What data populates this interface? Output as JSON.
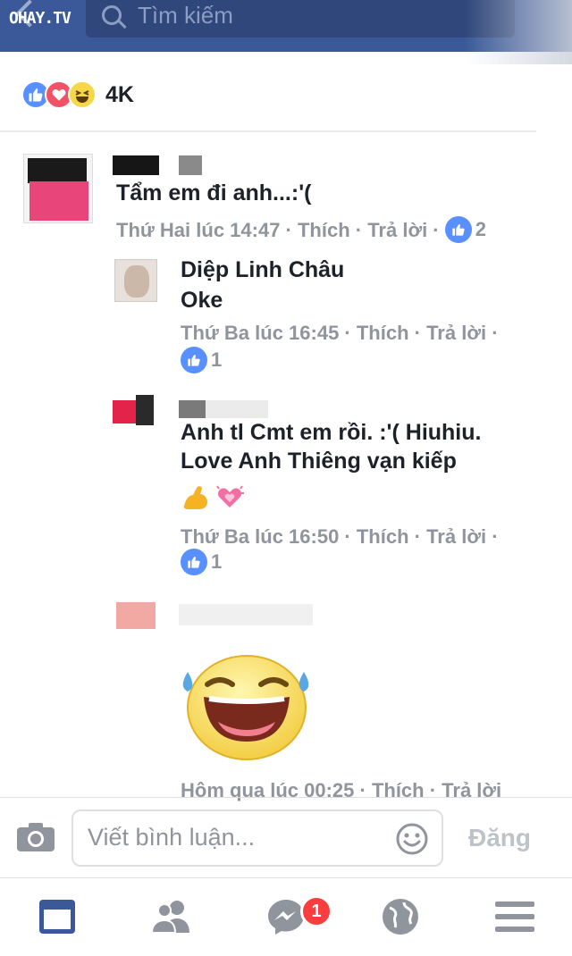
{
  "header": {
    "brand": "OHAY.TV",
    "search_placeholder": "Tìm kiếm"
  },
  "reactions": {
    "icons": [
      "like-icon",
      "love-icon",
      "haha-icon"
    ],
    "count": "4K"
  },
  "comments": [
    {
      "name": "",
      "text": "Tẩm em đi anh...:'(",
      "meta": "Thứ Hai lúc 14:47 · Thích · Trả lời ·",
      "likes": "2"
    },
    {
      "name": "Diệp Linh Châu",
      "text": "Oke",
      "meta": "Thứ Ba lúc 16:45 · Thích · Trả lời ·",
      "likes": "1"
    },
    {
      "name": "",
      "text_line1": "Anh tl Cmt em rồi. :'( Hiuhiu.",
      "text_line2": "Love Anh Thiêng vạn kiếp",
      "meta": "Thứ Ba lúc 16:50 · Thích · Trả lời ·",
      "likes": "1"
    },
    {
      "name": "",
      "sticker": "laughing-tears-sticker",
      "meta": "Hôm qua lúc 00:25 · Thích · Trả lời"
    }
  ],
  "composer": {
    "placeholder": "Viết bình luận...",
    "post_label": "Đăng"
  },
  "tabbar": {
    "items": [
      "news-feed-icon",
      "friends-icon",
      "messenger-icon",
      "notifications-globe-icon",
      "menu-icon"
    ],
    "messenger_badge": "1"
  },
  "colors": {
    "header_bg": "#3b5998",
    "like_blue": "#5890ff",
    "meta_gray": "#90949c",
    "badge_red": "#fa3e3e"
  }
}
